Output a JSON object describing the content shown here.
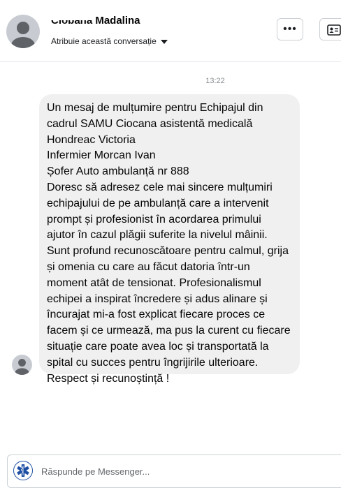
{
  "header": {
    "contact_name": "Ciobană Madalina",
    "assign_label": "Atribuie această conversație",
    "more_label": "•••"
  },
  "thread": {
    "timestamp": "13:22",
    "message_lines": [
      "Un mesaj de mulțumire pentru Echipajul din",
      "cadrul SAMU Ciocana asistentă medicală",
      "Hondreac Victoria",
      "Infermier Morcan Ivan",
      "Șofer Auto ambulanță nr 888",
      "Doresc să adresez cele mai sincere mulțumiri",
      "echipajului de pe ambulanță care a intervenit",
      "prompt și profesionist în acordarea primului",
      "ajutor în cazul plăgii suferite la nivelul mâinii.",
      "Sunt profund recunoscătoare pentru calmul, grija",
      "și omenia cu care au făcut datoria într-un",
      "moment atât de tensionat. Profesionalismul",
      "echipei a inspirat încredere și adus alinare și",
      "încurajat mi-a fost explicat fiecare proces ce",
      "facem și ce urmează, ma pus la curent cu fiecare",
      "situație care poate avea loc și transportată la",
      "spital cu succes pentru îngrijirile ulterioare.",
      "Respect și recunoștință !"
    ]
  },
  "composer": {
    "placeholder": "Răspunde pe Messenger..."
  },
  "colors": {
    "bubble_bg": "#f0f0f0",
    "brand_blue": "#1f4fa3",
    "avatar_gray": "#c8ccd2"
  }
}
